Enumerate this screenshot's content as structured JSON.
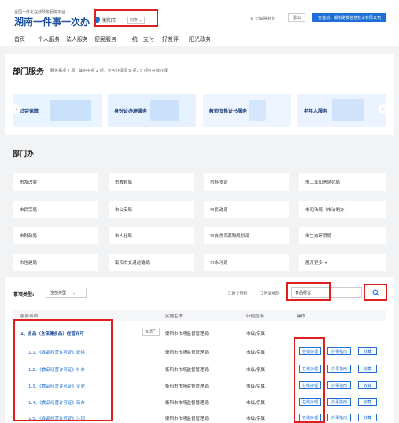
{
  "header": {
    "subtitle": "全国一体化在线政务服务平台",
    "title": "湖南一件事一次办",
    "city": "衡阳市",
    "city_switch": "切换",
    "accessibility": "无障碍浏览",
    "logout": "退出",
    "user": "安益创、湖南路发信息技术有限公司",
    "nav": [
      "首页",
      "个人服务",
      "法人服务",
      "便民服务",
      "统一支付",
      "好差评",
      "阳光政务"
    ]
  },
  "dept_service": {
    "title": "部门服务",
    "stats": "服务事项 7 项，其中主项 2 项，业务办理项 5 项，5 项可在线办理"
  },
  "banners": [
    {
      "label": "社会保障",
      "color": "#e8f4ff"
    },
    {
      "label": "身份证办理服务",
      "color": "#e6f1ff"
    },
    {
      "label": "教师资格证书服务",
      "color": "#eef5ff"
    },
    {
      "label": "老年人服务",
      "color": "#eaf3ff"
    }
  ],
  "dept_office": {
    "title": "部门办",
    "items": [
      [
        "市发改委",
        "市教育局",
        "市科技局",
        "市工业和信息化局"
      ],
      [
        "市民宗局",
        "市公安局",
        "市民政局",
        "市司法局（市法制办）"
      ],
      [
        "市财政局",
        "市人社局",
        "市自然资源和规划局",
        "市生态环境局"
      ],
      [
        "市住建局",
        "衡阳市交通运输局",
        "市水利局",
        "展开更多 +"
      ]
    ]
  },
  "filter": {
    "label": "事项类型:",
    "type_value": "全部类型",
    "opt1": "网上预约",
    "opt2": "全程网办",
    "search_value": "食品经营"
  },
  "table": {
    "headers": [
      "服务事项",
      "实施主体",
      "行使层级",
      "操作"
    ],
    "main_item": {
      "name": "1、食品（含保健食品）经营许可",
      "count": "5项",
      "subject": "衡阳市市场监督管理局",
      "level": "市级/京属"
    },
    "rows": [
      {
        "name": "1.1、《食品经营许可证》延续",
        "subject": "衡阳市市场监督管理局",
        "level": "市级/京属"
      },
      {
        "name": "1.2、《食品经营许可证》补办",
        "subject": "衡阳市市场监督管理局",
        "level": "市级/京属"
      },
      {
        "name": "1.3、《食品经营许可证》变更",
        "subject": "衡阳市市场监督管理局",
        "level": "市级/京属"
      },
      {
        "name": "1.4、《食品经营许可证》新办",
        "subject": "衡阳市市场监督管理局",
        "level": "市级/京属"
      },
      {
        "name": "1.5、《食品经营许可证》注销",
        "subject": "衡阳市市场监督管理局",
        "level": "市级/京属"
      }
    ],
    "action_online": "在线办理",
    "action_guide": "办事指南",
    "action_fav": "收藏"
  }
}
